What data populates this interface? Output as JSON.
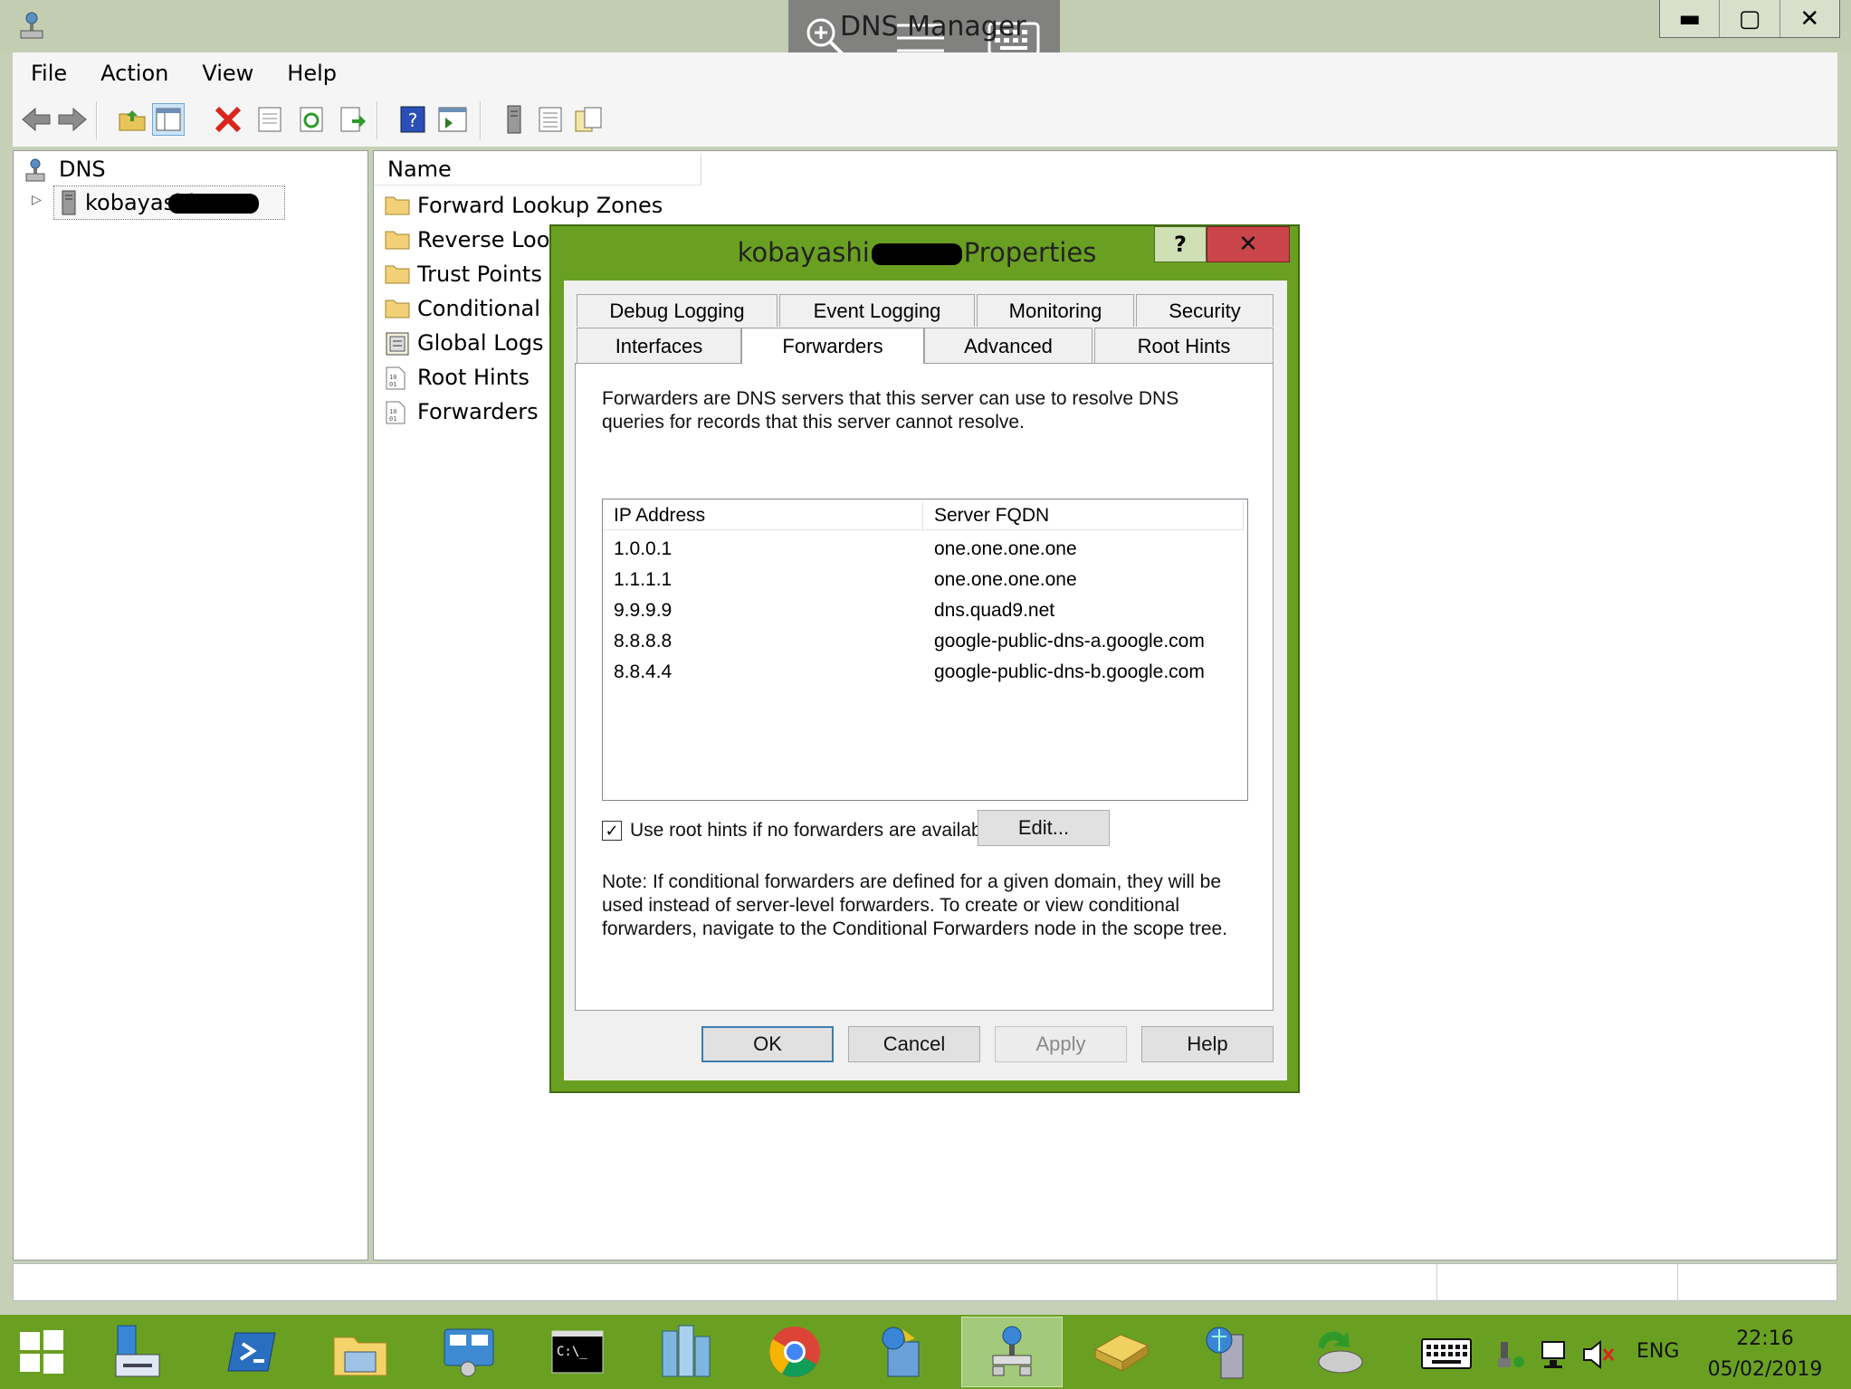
{
  "remote": {
    "window_title": "DNS Manager"
  },
  "window_controls": {
    "minimize": "▬",
    "maximize": "▢",
    "close": "✕"
  },
  "menu": [
    "File",
    "Action",
    "View",
    "Help"
  ],
  "tree": {
    "root": "DNS",
    "server": "kobayashi"
  },
  "list": {
    "header": "Name",
    "items": [
      {
        "label": "Forward Lookup Zones",
        "icon": "folder-icon"
      },
      {
        "label": "Reverse Looku",
        "icon": "folder-icon"
      },
      {
        "label": "Trust Points",
        "icon": "folder-icon"
      },
      {
        "label": "Conditional Fo",
        "icon": "folder-icon"
      },
      {
        "label": "Global Logs",
        "icon": "log-icon"
      },
      {
        "label": "Root Hints",
        "icon": "binary-file-icon"
      },
      {
        "label": "Forwarders",
        "icon": "binary-file-icon"
      }
    ]
  },
  "dialog": {
    "title_left": "kobayashi",
    "title_right": "Properties",
    "help_btn": "?",
    "close_btn": "✕",
    "tabs_row1": [
      "Debug Logging",
      "Event Logging",
      "Monitoring",
      "Security"
    ],
    "tabs_row2": [
      "Interfaces",
      "Forwarders",
      "Advanced",
      "Root Hints"
    ],
    "description_line1": "Forwarders are DNS servers that this server can use to resolve DNS",
    "description_line2": "queries for records that this server cannot resolve.",
    "columns": [
      "IP Address",
      "Server FQDN"
    ],
    "forwarders": [
      {
        "ip": "1.0.0.1",
        "fqdn": "one.one.one.one"
      },
      {
        "ip": "1.1.1.1",
        "fqdn": "one.one.one.one"
      },
      {
        "ip": "9.9.9.9",
        "fqdn": "dns.quad9.net"
      },
      {
        "ip": "8.8.8.8",
        "fqdn": "google-public-dns-a.google.com"
      },
      {
        "ip": "8.8.4.4",
        "fqdn": "google-public-dns-b.google.com"
      }
    ],
    "use_root_hints_label": "Use root hints if no forwarders are available",
    "use_root_hints_checked": true,
    "check_mark": "✓",
    "edit_button": "Edit...",
    "note_line1": "Note: If conditional forwarders are defined for a given domain, they will be",
    "note_line2": "used instead of server-level forwarders.  To create or view conditional",
    "note_line3": "forwarders, navigate to the Conditional Forwarders node in the scope tree.",
    "buttons": {
      "ok": "OK",
      "cancel": "Cancel",
      "apply": "Apply",
      "help": "Help"
    }
  },
  "tray": {
    "language": "ENG",
    "time": "22:16",
    "date": "05/02/2019"
  },
  "colors": {
    "taskbar": "#6aa022",
    "dialog_frame": "#6aa022",
    "close_red": "#c9454a"
  }
}
